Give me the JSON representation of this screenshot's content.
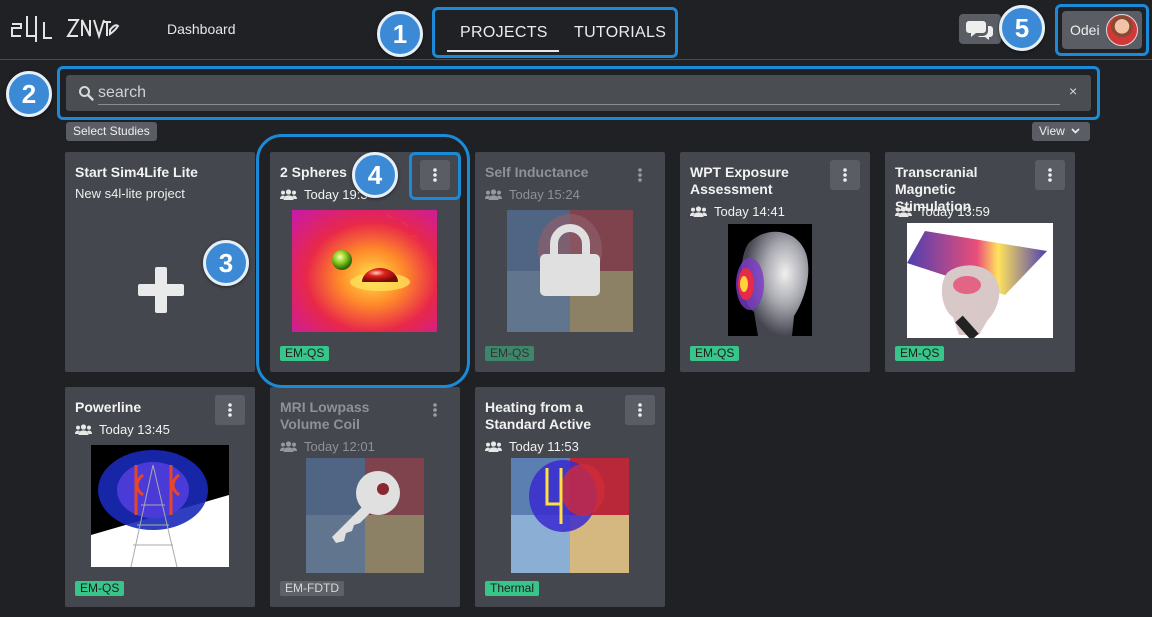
{
  "app": {
    "logo_text": "s4L ZNT",
    "nav_dashboard": "Dashboard"
  },
  "tabs": [
    {
      "label": "PROJECTS",
      "active": true
    },
    {
      "label": "TUTORIALS",
      "active": false
    }
  ],
  "user": {
    "name": "Odei"
  },
  "search": {
    "placeholder": "search",
    "value": "",
    "clear": "×"
  },
  "toolbar": {
    "select_studies": "Select Studies",
    "view": "View"
  },
  "callouts": [
    "1",
    "2",
    "3",
    "4",
    "5"
  ],
  "cards": [
    {
      "title": "Start Sim4Life Lite",
      "subtitle": "New s4l-lite project"
    },
    {
      "title": "2 Spheres",
      "date": "Today 19:3",
      "tag": "EM-QS"
    },
    {
      "title": "Self Inductance",
      "date": "Today 15:24",
      "tag": "EM-QS"
    },
    {
      "title": "WPT Exposure Assessment",
      "date": "Today 14:41",
      "tag": "EM-QS"
    },
    {
      "title": "Transcranial Magnetic Stimulation",
      "date": "Today 13:59",
      "tag": "EM-QS"
    },
    {
      "title": "Powerline",
      "date": "Today 13:45",
      "tag": "EM-QS"
    },
    {
      "title": "MRI Lowpass Volume Coil",
      "date": "Today 12:01",
      "tag": "EM-FDTD"
    },
    {
      "title": "Heating from a Standard Active",
      "date": "Today 11:53",
      "tag": "Thermal"
    }
  ],
  "colors": {
    "accent": "#1b8ad8",
    "badge": "#3c8ad6",
    "tag_green": "#38c58a",
    "background": "#1f2125",
    "card": "#44474d"
  }
}
